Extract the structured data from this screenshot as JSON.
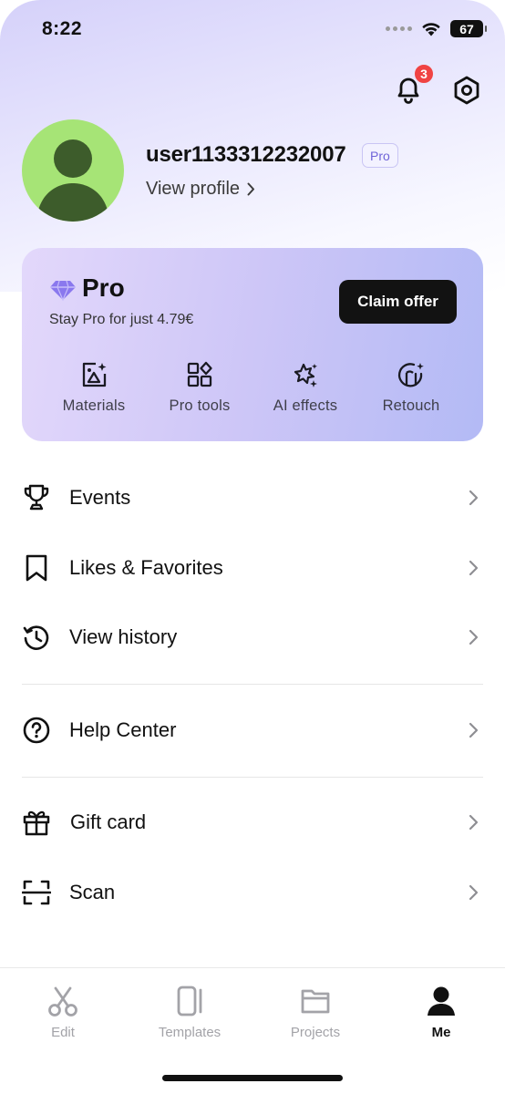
{
  "status_bar": {
    "time": "8:22",
    "battery": "67"
  },
  "header": {
    "notification_count": "3"
  },
  "profile": {
    "username": "user1133312232007",
    "badge": "Pro",
    "view_profile": "View profile"
  },
  "pro_card": {
    "title": "Pro",
    "subtitle": "Stay Pro for just 4.79€",
    "cta": "Claim offer",
    "features": [
      {
        "label": "Materials",
        "icon": "image-sparkle-icon"
      },
      {
        "label": "Pro tools",
        "icon": "grid-tools-icon"
      },
      {
        "label": "AI effects",
        "icon": "magic-stars-icon"
      },
      {
        "label": "Retouch",
        "icon": "face-retouch-icon"
      }
    ]
  },
  "menu": [
    {
      "label": "Events",
      "icon": "trophy-icon"
    },
    {
      "label": "Likes & Favorites",
      "icon": "bookmark-icon"
    },
    {
      "label": "View history",
      "icon": "history-clock-icon"
    },
    {
      "label": "Help Center",
      "icon": "question-circle-icon"
    },
    {
      "label": "Gift card",
      "icon": "gift-icon"
    },
    {
      "label": "Scan",
      "icon": "scan-icon"
    }
  ],
  "tab_bar": {
    "tabs": [
      {
        "label": "Edit",
        "icon": "scissors-icon",
        "active": false
      },
      {
        "label": "Templates",
        "icon": "templates-icon",
        "active": false
      },
      {
        "label": "Projects",
        "icon": "folder-icon",
        "active": false
      },
      {
        "label": "Me",
        "icon": "person-icon",
        "active": true
      }
    ]
  },
  "colors": {
    "accent": "#6f64d8",
    "badge_red": "#f04343",
    "avatar_green": "#a6e476",
    "cta_bg": "#121212"
  }
}
